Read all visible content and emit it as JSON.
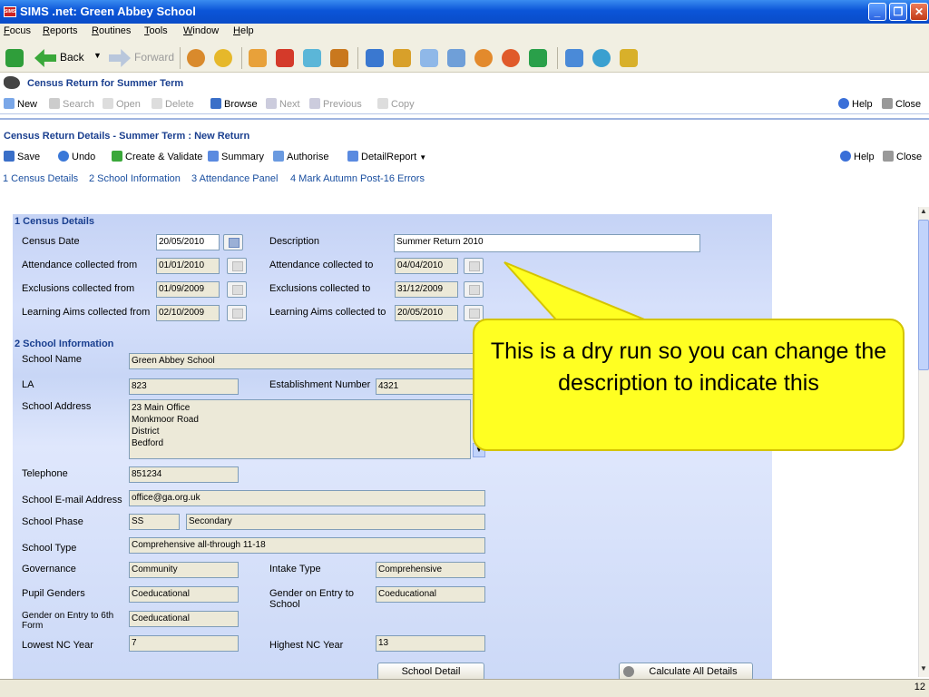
{
  "window": {
    "title": "SIMS .net: Green Abbey School",
    "logo_text": "SIMS"
  },
  "menu": [
    "Focus",
    "Reports",
    "Routines",
    "Tools",
    "Window",
    "Help"
  ],
  "toolbar": {
    "back_label": "Back",
    "forward_label": "Forward"
  },
  "census_return": {
    "title": "Census Return for Summer Term",
    "buttons": {
      "new": "New",
      "search": "Search",
      "open": "Open",
      "delete": "Delete",
      "browse": "Browse",
      "next": "Next",
      "previous": "Previous",
      "copy": "Copy",
      "help": "Help",
      "close": "Close"
    }
  },
  "details": {
    "title": "Census Return Details - Summer Term : New Return",
    "buttons": {
      "save": "Save",
      "undo": "Undo",
      "create_validate": "Create & Validate",
      "summary": "Summary",
      "authorise": "Authorise",
      "detail_report": "DetailReport",
      "help": "Help",
      "close": "Close"
    },
    "links": [
      "1 Census Details",
      "2 School Information",
      "3 Attendance Panel",
      "4 Mark Autumn Post-16 Errors"
    ]
  },
  "census_details": {
    "heading": "1 Census Details",
    "census_date": {
      "label": "Census Date",
      "value": "20/05/2010"
    },
    "description": {
      "label": "Description",
      "value": "Summer Return 2010"
    },
    "attendance_from": {
      "label": "Attendance collected from",
      "value": "01/01/2010"
    },
    "attendance_to": {
      "label": "Attendance collected to",
      "value": "04/04/2010"
    },
    "exclusions_from": {
      "label": "Exclusions collected from",
      "value": "01/09/2009"
    },
    "exclusions_to": {
      "label": "Exclusions collected to",
      "value": "31/12/2009"
    },
    "learning_from": {
      "label": "Learning Aims collected from",
      "value": "02/10/2009"
    },
    "learning_to": {
      "label": "Learning Aims collected to",
      "value": "20/05/2010"
    }
  },
  "school_info": {
    "heading": "2 School Information",
    "school_name": {
      "label": "School Name",
      "value": "Green Abbey School"
    },
    "la": {
      "label": "LA",
      "value": "823"
    },
    "establishment": {
      "label": "Establishment Number",
      "value": "4321"
    },
    "address": {
      "label": "School Address",
      "lines": [
        "23     Main Office",
        "Monkmoor Road",
        "District",
        "Bedford"
      ]
    },
    "telephone": {
      "label": "Telephone",
      "value": "851234"
    },
    "email": {
      "label": "School E-mail Address",
      "value": "office@ga.org.uk"
    },
    "phase": {
      "label": "School Phase",
      "code": "SS",
      "value": "Secondary"
    },
    "type": {
      "label": "School Type",
      "value": "Comprehensive all-through 11-18"
    },
    "governance": {
      "label": "Governance",
      "value": "Community"
    },
    "intake": {
      "label": "Intake Type",
      "value": "Comprehensive"
    },
    "pupil_genders": {
      "label": "Pupil Genders",
      "value": "Coeducational"
    },
    "gender_entry": {
      "label": "Gender on Entry to School",
      "value": "Coeducational"
    },
    "gender_6th": {
      "label": "Gender on Entry to 6th Form",
      "value": "Coeducational"
    },
    "lowest_nc": {
      "label": "Lowest NC Year",
      "value": "7"
    },
    "highest_nc": {
      "label": "Highest NC Year",
      "value": "13"
    },
    "school_detail_button": "School Detail",
    "calculate_button": "Calculate All Details"
  },
  "callout": {
    "text": "This is a dry run so you can change the description to indicate this"
  },
  "status": {
    "page_number": "12"
  }
}
